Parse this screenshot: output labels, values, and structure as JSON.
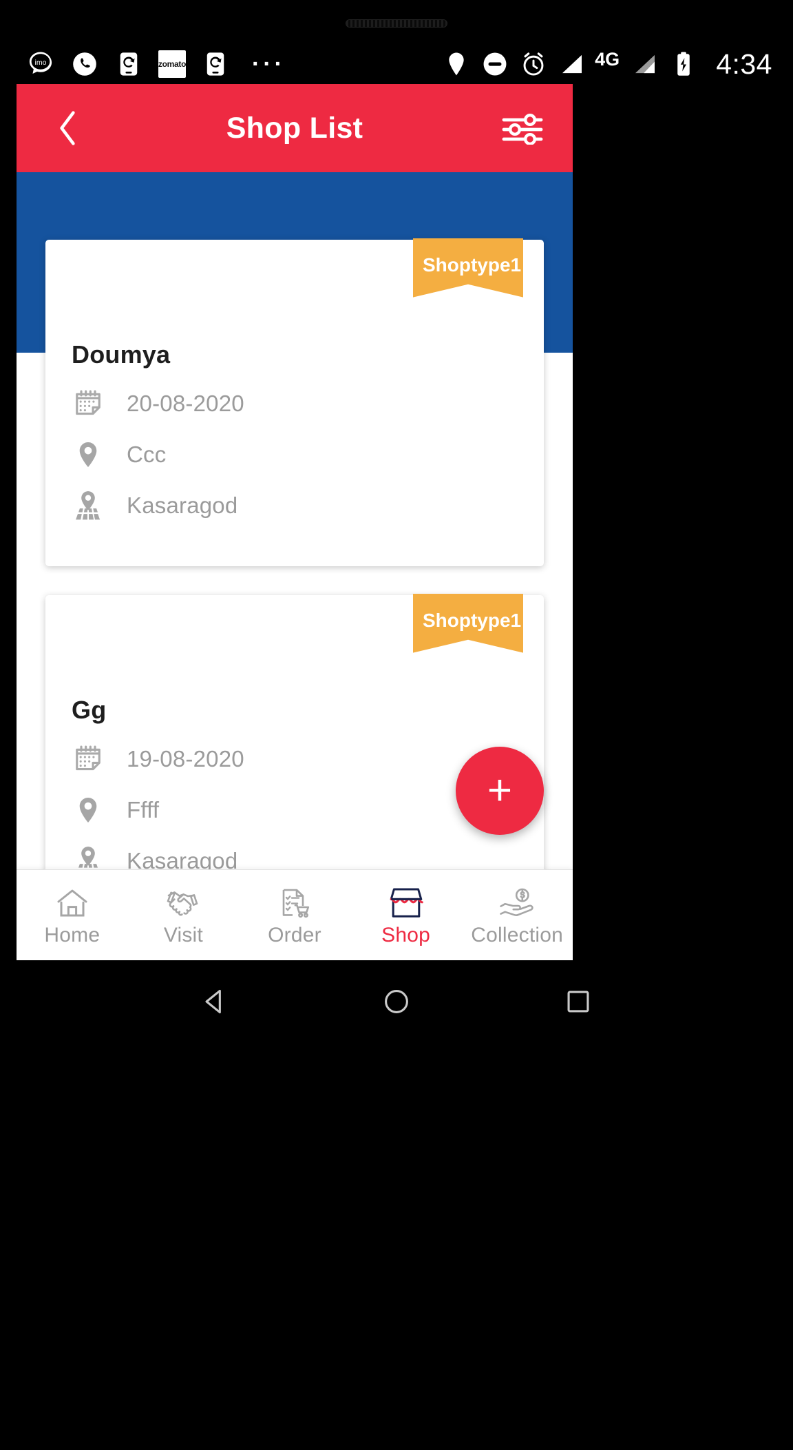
{
  "theme": {
    "brand_red": "#EE2A42",
    "header_blue": "#15539E",
    "ribbon_orange": "#F4AE41",
    "muted_gray": "#9B9B9B"
  },
  "statusbar": {
    "icons": [
      "imo-icon",
      "phone-call-icon",
      "screen-rotate-icon",
      "zomato-icon",
      "screen-rotate-icon-2",
      "more-dots-icon",
      "location-icon",
      "do-not-disturb-icon",
      "alarm-clock-icon",
      "signal-bars-icon",
      "signal-bars-icon-2",
      "battery-charging-icon"
    ],
    "zomato_label": "zomato",
    "network_type": "4G",
    "dots": "···",
    "time": "4:34"
  },
  "appbar": {
    "title": "Shop List",
    "back_icon": "chevron-left-icon",
    "filter_icon": "filter-sliders-icon"
  },
  "shops": [
    {
      "name": "Doumya",
      "badge": "Shoptype1",
      "date": "20-08-2020",
      "place": "Ccc",
      "district": "Kasaragod"
    },
    {
      "name": "Gg",
      "badge": "Shoptype1",
      "date": "19-08-2020",
      "place": "Ffff",
      "district": "Kasaragod"
    }
  ],
  "fab": {
    "label": "+",
    "icon": "plus-icon"
  },
  "bottomnav": {
    "items": [
      {
        "label": "Home",
        "icon": "home-icon",
        "active": false
      },
      {
        "label": "Visit",
        "icon": "handshake-icon",
        "active": false
      },
      {
        "label": "Order",
        "icon": "order-cart-icon",
        "active": false
      },
      {
        "label": "Shop",
        "icon": "storefront-icon",
        "active": true
      },
      {
        "label": "Collection",
        "icon": "money-hand-icon",
        "active": false
      }
    ]
  },
  "sysnav": {
    "back": "back-triangle-icon",
    "home": "home-circle-icon",
    "recents": "recents-square-icon"
  }
}
